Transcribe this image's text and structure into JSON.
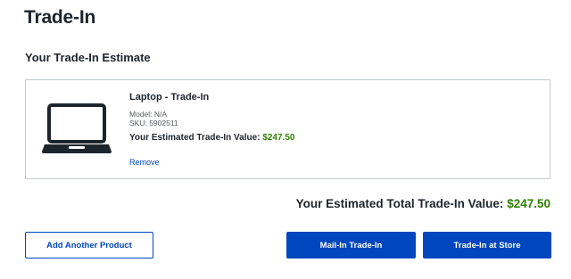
{
  "page": {
    "title": "Trade-In"
  },
  "estimate": {
    "section_title": "Your Trade-In Estimate",
    "item": {
      "icon": "laptop-icon",
      "name": "Laptop - Trade-In",
      "model": "Model: N/A",
      "sku": "SKU: 5902511",
      "value_label": "Your Estimated Trade-In Value:",
      "value": "$247.50",
      "remove_label": "Remove"
    }
  },
  "total": {
    "label": "Your Estimated Total Trade-In Value:",
    "value": "$247.50"
  },
  "actions": {
    "add_another": "Add Another Product",
    "mail_in": "Mail-In Trade-In",
    "at_store": "Trade-In at Store"
  },
  "colors": {
    "primary": "#0046be",
    "price_green": "#318000",
    "text": "#1d252c",
    "border": "#c5cbd5"
  }
}
